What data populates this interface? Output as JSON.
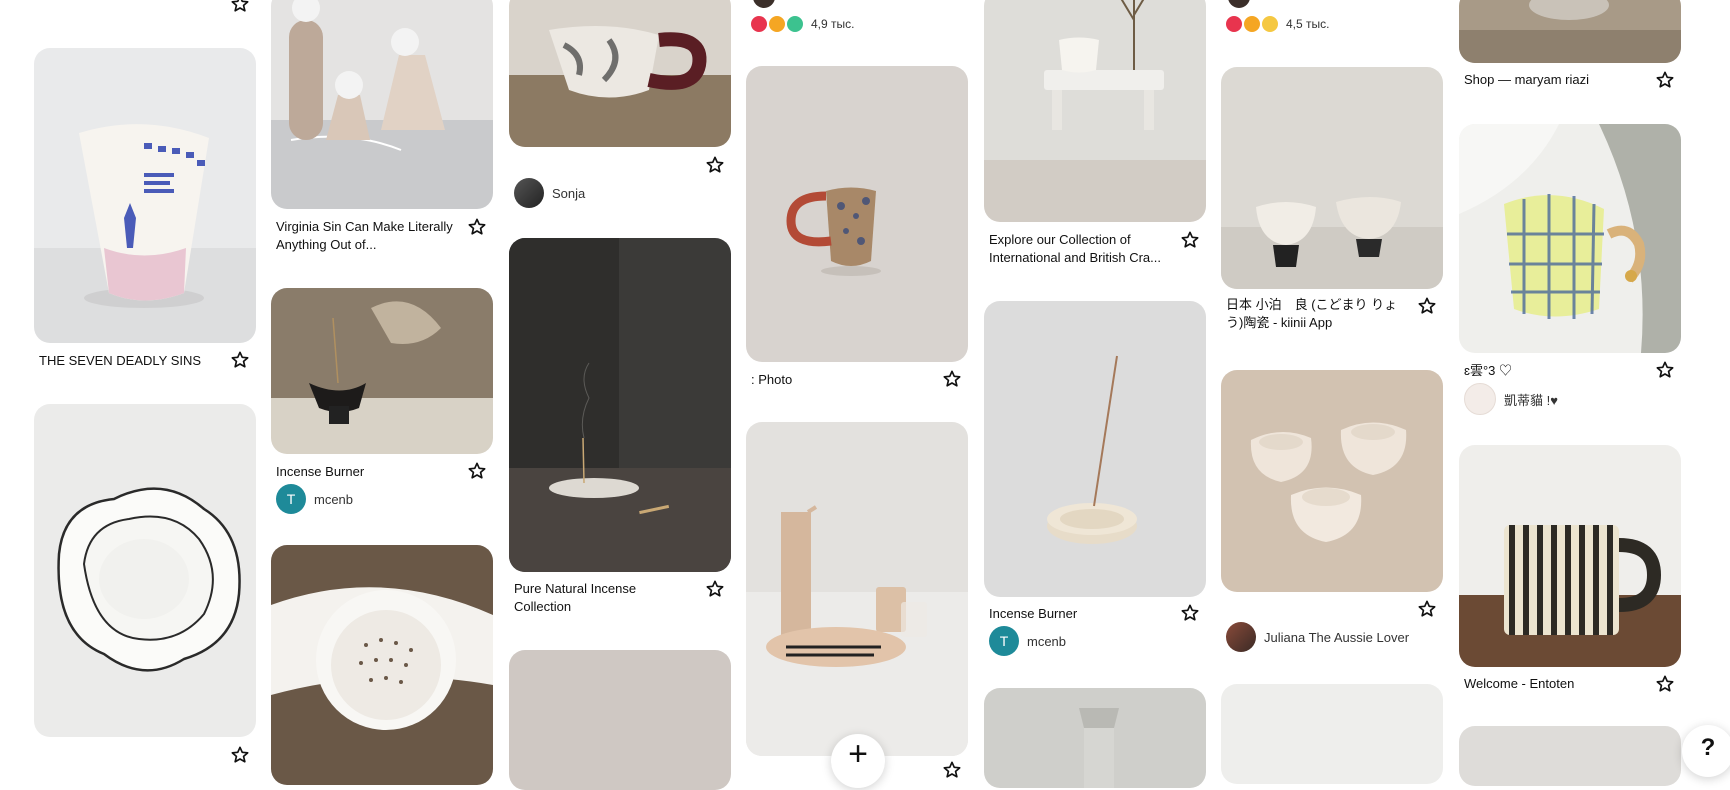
{
  "pins": {
    "c1": {
      "seven_deadly_sins": "THE SEVEN DEADLY SINS"
    },
    "c2": {
      "virginia_sin": "Virginia Sin Can Make Literally Anything Out of...",
      "incense_burner": "Incense Burner",
      "incense_author": "mcenb",
      "incense_author_initial": "T"
    },
    "c3": {
      "sonja_author": "Sonja",
      "pure_natural": "Pure Natural Incense Collection"
    },
    "c4": {
      "reactions_count": "4,9 тыс.",
      "photo_title": ": Photo"
    },
    "c5": {
      "explore_collection": "Explore our Collection of International and British Cra...",
      "incense_burner": "Incense Burner",
      "incense_author": "mcenb",
      "incense_author_initial": "T"
    },
    "c6": {
      "reactions_count": "4,5 тыс.",
      "japanese_title": "日本 小泊　良 (こどまり りょう)陶瓷 - kiinii App",
      "juliana_author": "Juliana The Aussie Lover"
    },
    "c7": {
      "shop_title": "Shop — maryam riazi",
      "cloud_title": "ɛ雲°3 ♡",
      "cloud_author": "凱蒂貓 !♥",
      "welcome_title": "Welcome - Entoten"
    }
  },
  "controls": {
    "create_label": "+",
    "help_label": "?"
  },
  "colors": {
    "avatar_teal": "#1e8a99",
    "reaction_heart": "#e8344e",
    "reaction_wow": "#f5a623",
    "reaction_star": "#3cc28f"
  },
  "icons": [
    "star-icon",
    "plus-icon",
    "help-icon"
  ]
}
